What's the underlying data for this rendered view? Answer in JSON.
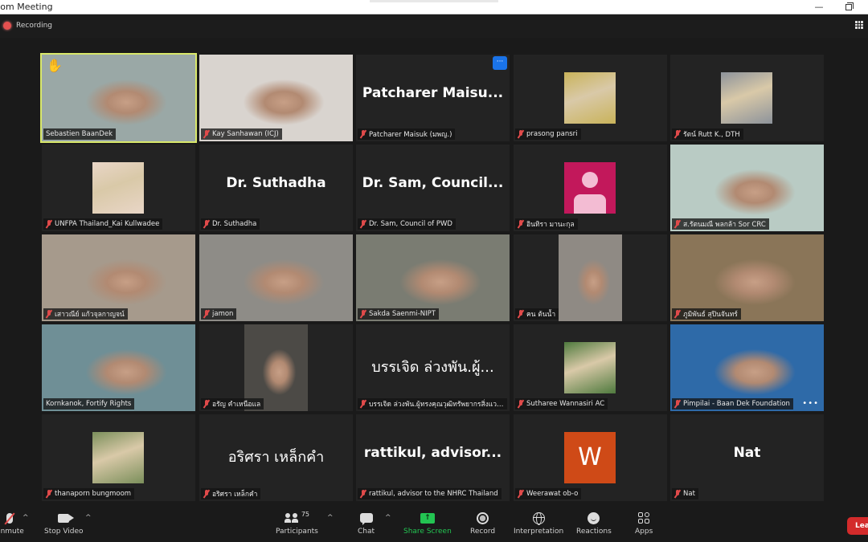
{
  "window": {
    "title": "Zoom Meeting",
    "minimize_glyph": "—",
    "maximize_glyph": "restore"
  },
  "topbar": {
    "recording_label": "Recording",
    "view_label": "View"
  },
  "gallery": {
    "active_speaker": "Sebastien BaanDek",
    "tiles": [
      {
        "name": "Sebastien BaanDek",
        "display": "video",
        "raised_hand": true,
        "speaker": true,
        "muted": false,
        "bg": "#9aa8a6"
      },
      {
        "name": "Kay Sanhawan (ICJ)",
        "display": "video",
        "muted": true,
        "bg": "#d9d4cf"
      },
      {
        "name": "Patcharer Maisuk (มพญ.)",
        "display": "name",
        "big_text": "Patcharer  Maisu...",
        "muted": true,
        "more_options": true
      },
      {
        "name": "prasong pansri",
        "display": "photo",
        "muted": true,
        "photo_color": "#c9b35a"
      },
      {
        "name": "รัตน์ Rutt K., DTH",
        "display": "photo",
        "muted": true,
        "photo_color": "#8d939b"
      },
      {
        "name": "UNFPA Thailand_Kai Kullwadee",
        "display": "photo",
        "muted": true,
        "photo_color": "#e9d6c7"
      },
      {
        "name": "Dr. Suthadha",
        "display": "name",
        "big_text": "Dr. Suthadha",
        "muted": true
      },
      {
        "name": "Dr. Sam, Council of PWD",
        "display": "name",
        "big_text": "Dr. Sam, Council...",
        "muted": true
      },
      {
        "name": "อินทิรา  มานะกุล",
        "display": "default-avatar",
        "muted": true
      },
      {
        "name": "ส.รัตนมณี พลกล้า Sor CRC",
        "display": "video",
        "muted": true,
        "bg": "#b9cbc4"
      },
      {
        "name": "เสาวณีย์ แก้วจุลกาญจน์",
        "display": "video",
        "muted": true,
        "bg": "#a69a8c"
      },
      {
        "name": "jamon",
        "display": "video",
        "muted": true,
        "bg": "#8e8c87"
      },
      {
        "name": "Sakda Saenmi-NIPT",
        "display": "video",
        "muted": true,
        "bg": "#7a7c72"
      },
      {
        "name": "คน ต้นน้ำ",
        "display": "portrait-video",
        "muted": true,
        "bg": "#8f8a84"
      },
      {
        "name": "ภูมิพันธ์ สุปินจันทร์",
        "display": "video",
        "muted": true,
        "bg": "#8a7558"
      },
      {
        "name": "Kornkanok, Fortify Rights",
        "display": "video",
        "muted": false,
        "bg": "#6f8f96"
      },
      {
        "name": "อรัญ คำเหนือแล",
        "display": "portrait-video",
        "muted": true,
        "bg": "#4c4a46"
      },
      {
        "name": "บรรเจิด ล่วงพัน.ผู้ทรงคุณวุฒิทรัพยากรสิ่งแวดล้...",
        "display": "name",
        "big_text": "บรรเจิด ล่วงพัน.ผู้...",
        "thai": true,
        "muted": true
      },
      {
        "name": "Sutharee Wannasiri AC",
        "display": "photo",
        "muted": true,
        "photo_color": "#4f7a3e"
      },
      {
        "name": "Pimpilai - Baan Dek Foundation",
        "display": "video",
        "muted": true,
        "bg": "#2e6aa8",
        "overlay_dots": true
      },
      {
        "name": "thanaporn bungmoom",
        "display": "photo",
        "muted": true,
        "photo_color": "#7b8f5b"
      },
      {
        "name": "อริศรา เหล็กคำ",
        "display": "name",
        "big_text": "อริศรา เหล็กคำ",
        "thai": true,
        "muted": true
      },
      {
        "name": "rattikul, advisor to the NHRC Thailand",
        "display": "name",
        "big_text": "rattikul,  advisor...",
        "muted": true
      },
      {
        "name": "Weerawat ob-o",
        "display": "initial",
        "initial": "W",
        "muted": true
      },
      {
        "name": "Nat",
        "display": "name",
        "big_text": "Nat",
        "muted": true
      }
    ]
  },
  "toolbar": {
    "unmute": "Unmute",
    "stop_video": "Stop Video",
    "participants": "Participants",
    "participant_count": "75",
    "chat": "Chat",
    "share_screen": "Share Screen",
    "record": "Record",
    "interpretation": "Interpretation",
    "reactions": "Reactions",
    "apps": "Apps",
    "leave": "Leave",
    "caret": "^"
  },
  "colors": {
    "speaker_outline": "#d9e86a",
    "share_green": "#23c552",
    "leave_red": "#d32b2b",
    "recording_red": "#e5504f",
    "default_avatar": "#c2185b",
    "initial_avatar": "#cf4a17",
    "more_badge": "#1a73e8"
  }
}
